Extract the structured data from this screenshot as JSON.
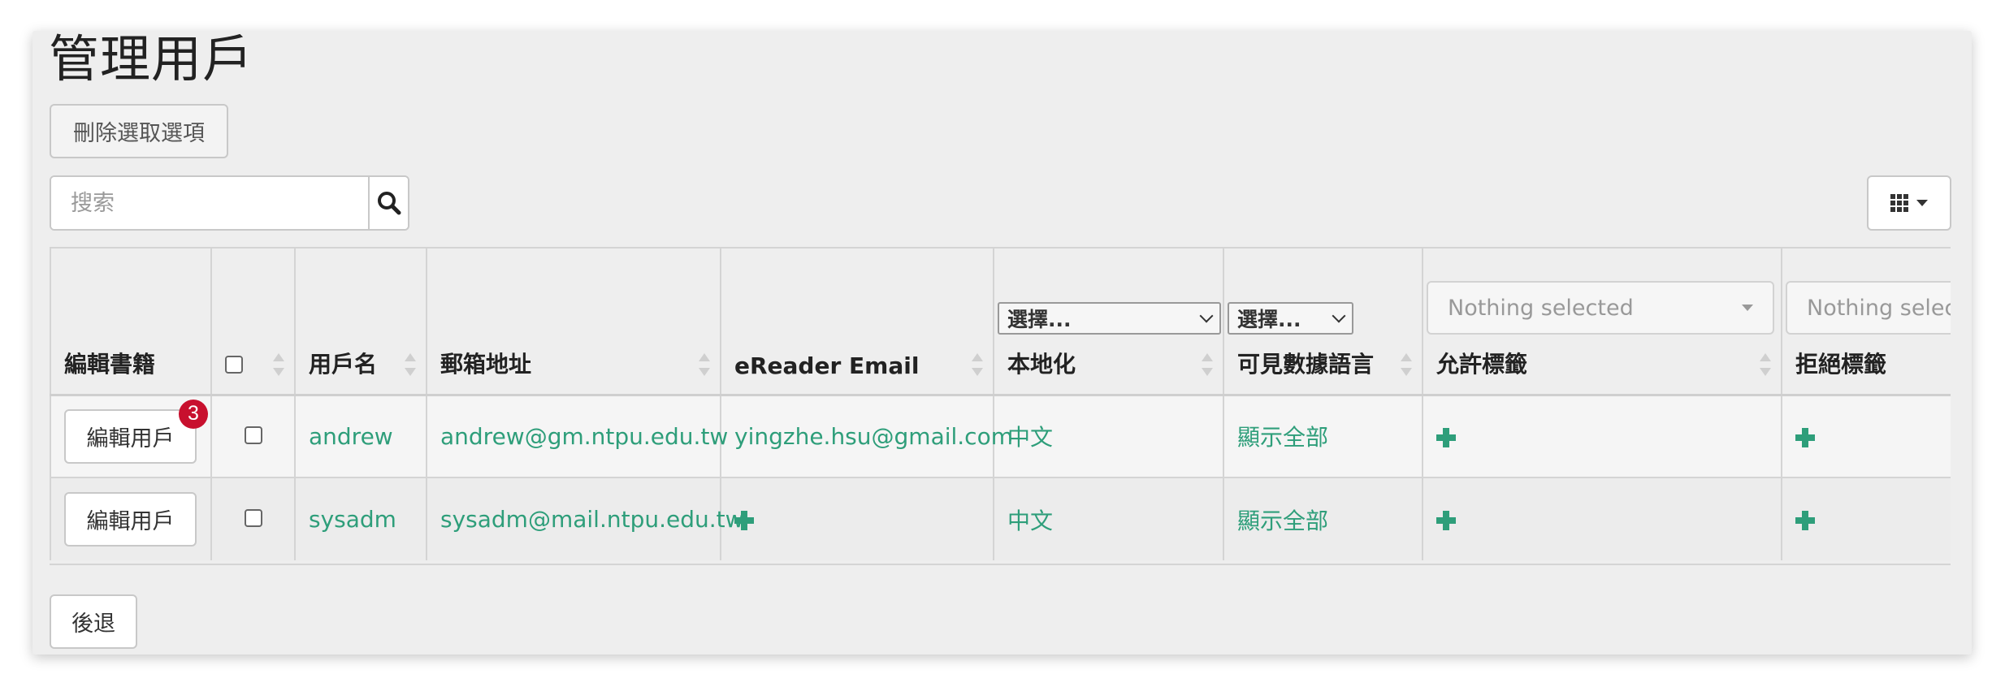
{
  "page": {
    "title": "管理用戶"
  },
  "toolbar": {
    "delete_label": "刪除選取選項",
    "search_placeholder": "搜索",
    "search_icon": "search-icon",
    "columns_icon": "grid-icon"
  },
  "table": {
    "headers": {
      "edit_books": "編輯書籍",
      "username": "用戶名",
      "email": "郵箱地址",
      "ereader_email": "eReader Email",
      "locale": "本地化",
      "visible_lang": "可見數據語言",
      "allowed_tags": "允許標籤",
      "denied_tags": "拒絕標籤"
    },
    "filters": {
      "locale": "選擇...",
      "visible_lang": "選擇...",
      "allowed_tags": "Nothing selected",
      "denied_tags": "Nothing selected"
    },
    "rows": [
      {
        "edit_label": "編輯用戶",
        "badge": "3",
        "username": "andrew",
        "email": "andrew@gm.ntpu.edu.tw",
        "ereader_email": "yingzhe.hsu@gmail.com",
        "locale": "中文",
        "visible_lang": "顯示全部"
      },
      {
        "edit_label": "編輯用戶",
        "username": "sysadm",
        "email": "sysadm@mail.ntpu.edu.tw",
        "ereader_email": "",
        "locale": "中文",
        "visible_lang": "顯示全部"
      }
    ]
  },
  "footer": {
    "back_label": "後退"
  },
  "colors": {
    "accent": "#2e9e7a",
    "badge": "#c8102e",
    "panel_bg": "#eeeeee"
  }
}
